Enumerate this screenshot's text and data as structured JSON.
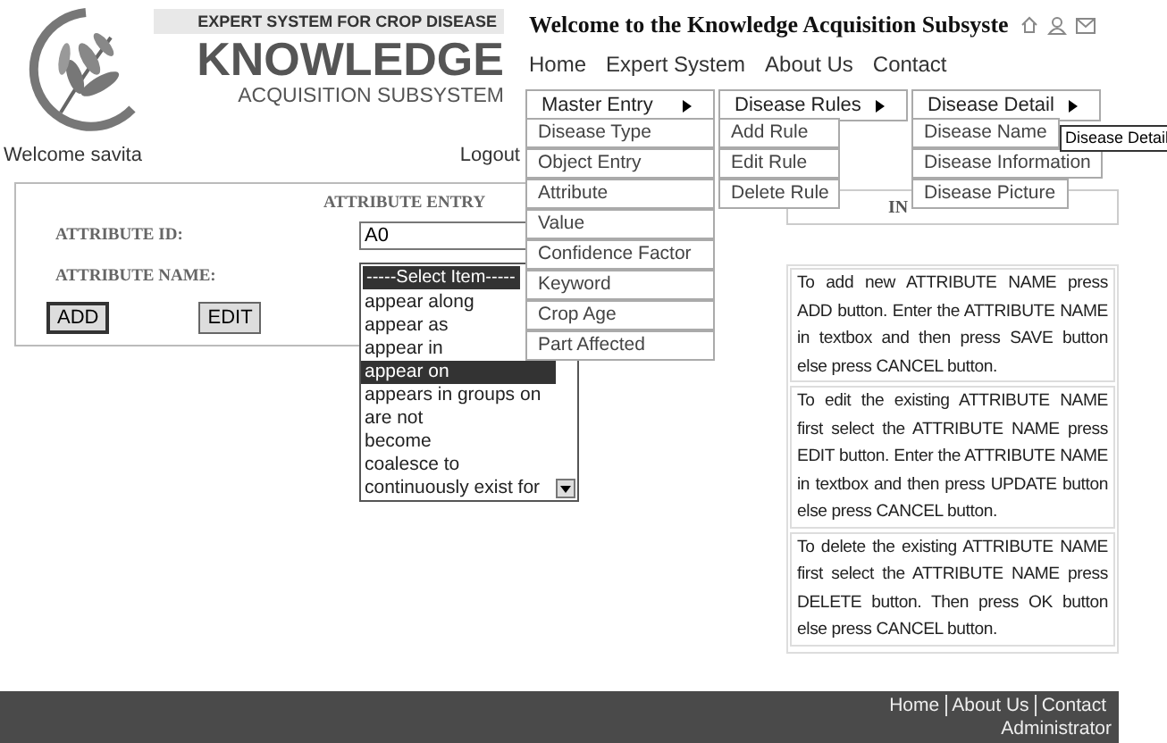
{
  "logo": {
    "tagline": "EXPERT SYSTEM FOR CROP DISEASE",
    "title": "KNOWLEDGE",
    "subtitle": "ACQUISITION SUBSYSTEM"
  },
  "header": {
    "title": "Welcome to the Knowledge Acquisition Subsyste",
    "nav": [
      "Home",
      "Expert System",
      "About Us",
      "Contact"
    ]
  },
  "user_bar": {
    "welcome": "Welcome savita",
    "logout": "Logout"
  },
  "attribute_entry": {
    "title": "ATTRIBUTE ENTRY",
    "id_label": "ATTRIBUTE ID:",
    "id_value": "A0",
    "name_label": "ATTRIBUTE NAME:",
    "buttons": [
      "ADD",
      "EDIT"
    ],
    "name_select": {
      "value": "-----Select Item-----",
      "options": [
        {
          "label": "appear along",
          "selected": false
        },
        {
          "label": "appear as",
          "selected": false
        },
        {
          "label": "appear in",
          "selected": false
        },
        {
          "label": "appear on",
          "selected": true
        },
        {
          "label": "appears in groups on",
          "selected": false
        },
        {
          "label": "are not",
          "selected": false
        },
        {
          "label": "become",
          "selected": false
        },
        {
          "label": "coalesce to",
          "selected": false
        },
        {
          "label": "continuously exist for",
          "selected": false
        }
      ]
    }
  },
  "instructions": {
    "title": "IN",
    "paragraphs": [
      "To add new ATTRIBUTE NAME press ADD button. Enter the ATTRIBUTE NAME in textbox and then press SAVE button else press CANCEL button.",
      "To edit the existing ATTRIBUTE NAME first select the ATTRIBUTE NAME press EDIT button. Enter the ATTRIBUTE NAME in textbox and then press UPDATE button else press CANCEL button.",
      "To delete the existing ATTRIBUTE NAME first select the ATTRIBUTE NAME press DELETE button. Then press OK button else press CANCEL button."
    ]
  },
  "menus": [
    {
      "label": "Master Entry",
      "items": [
        "Disease Type",
        "Object Entry",
        "Attribute",
        "Value",
        "Confidence Factor",
        "Keyword",
        "Crop Age",
        "Part Affected"
      ]
    },
    {
      "label": "Disease Rules",
      "items": [
        "Add Rule",
        "Edit Rule",
        "Delete Rule"
      ]
    },
    {
      "label": "Disease Detail",
      "items": [
        "Disease Name",
        "Disease Information",
        "Disease Picture"
      ]
    }
  ],
  "tooltip": "Disease Detail",
  "footer": {
    "links": [
      "Home",
      "About Us",
      "Contact"
    ],
    "role": "Administrator"
  }
}
